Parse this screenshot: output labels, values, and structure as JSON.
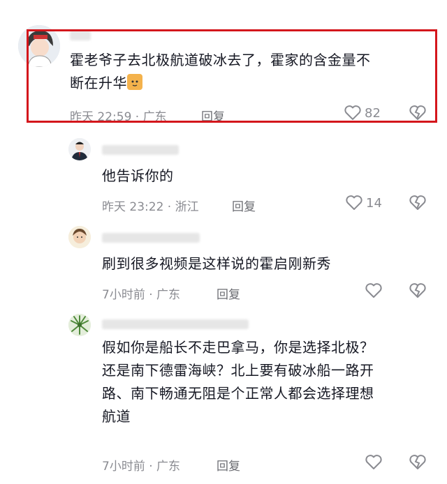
{
  "comments": [
    {
      "text": "霍老爷子去北极航道破冰去了，霍家的含金量不\n断在升华",
      "emoji": "cat-emoji",
      "time_location": "昨天 22:59 · 广东",
      "reply_label": "回复",
      "likes": "82"
    },
    {
      "text": "他告诉你的",
      "time_location": "昨天 23:22 · 浙江",
      "reply_label": "回复",
      "likes": "14"
    },
    {
      "text": "刷到很多视频是这样说的霍启刚新秀",
      "time_location": "7小时前 · 广东",
      "reply_label": "回复",
      "likes": ""
    },
    {
      "text": "假如你是船长不走巴拿马，你是选择北极？\n还是南下德雷海峡？北上要有破冰船一路开\n路、南下畅通无阻是个正常人都会选择理想\n航道",
      "time_location": "7小时前 · 广东",
      "reply_label": "回复",
      "likes": ""
    }
  ],
  "colors": {
    "highlight_border": "#d4161c",
    "meta_text": "#8a8b91",
    "body_text": "#161823"
  }
}
